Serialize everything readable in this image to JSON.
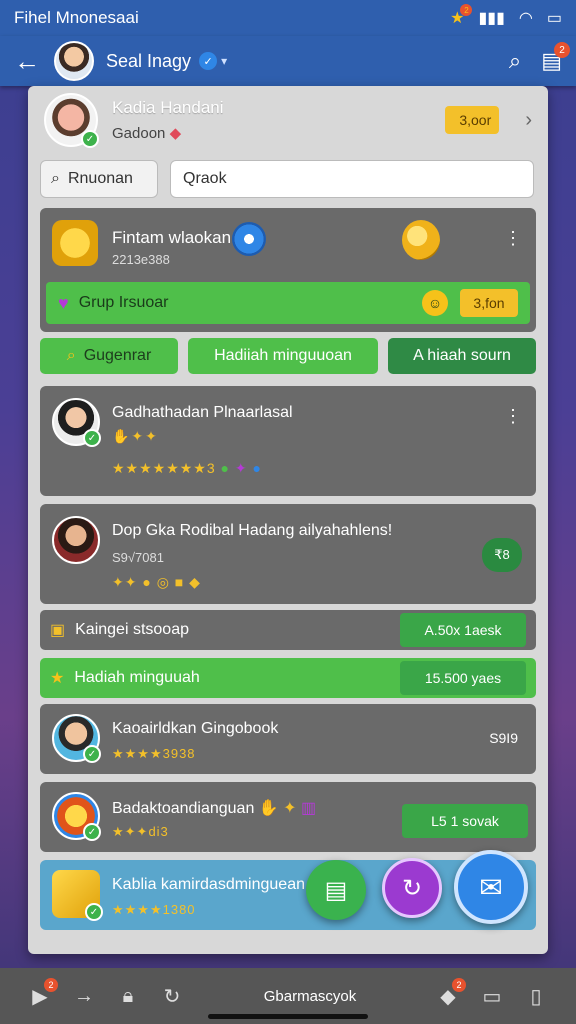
{
  "status_bar": {
    "carrier": "Fihel Mnonesaai",
    "star_badge": "2"
  },
  "app_bar": {
    "contact_name": "Seal Inagy",
    "notif_count": "2"
  },
  "profile": {
    "name": "Kadia Handani",
    "subtitle": "Gadoon",
    "coin_button": "3,oor"
  },
  "search": {
    "button_label": "Rnuonan",
    "input_value": "Qraok",
    "input_placeholder": ""
  },
  "event_card": {
    "title": "Fintam wlaokan",
    "subtitle": "2213e388",
    "strip_label": "Grup Irsuoar",
    "strip_button": "3,fon"
  },
  "tabs": [
    {
      "label": "Gugenrar"
    },
    {
      "label": "Hadiiah minguuoan"
    },
    {
      "label": "A hiaah sourn"
    }
  ],
  "user_cards": [
    {
      "name": "Gadhathadan Plnaarlasal",
      "stars": "★★★★★★★3"
    },
    {
      "name": "Dop Gka Rodibal Hadang ailyahahlens!",
      "subvalue": "S9√7081",
      "badge": "₹8"
    }
  ],
  "thin_rows": [
    {
      "label": "Kaingei stsooap",
      "value": "A.50x 1aesk"
    },
    {
      "label": "Hadiah minguuah",
      "value": "15.500 yaes"
    }
  ],
  "list_items": [
    {
      "title": "Kaoairldkan Gingobook",
      "stars": "★★★★3938",
      "right": "S9I9"
    },
    {
      "title": "Badaktoandianguan",
      "stars": "★✦✦di3",
      "right": "L5 1 sovak"
    },
    {
      "title": "Kablia kamirdasdminguean",
      "stars": "★★★★1380"
    }
  ],
  "bottom_bar": {
    "label": "Gbarmascyok",
    "badge1": "2",
    "badge2": "2"
  },
  "colors": {
    "appbar": "#2f5fae",
    "panel": "#d8d8d8",
    "card": "#6a6a6a",
    "green": "#4fbf4a",
    "gold": "#f3c02a",
    "blue": "#2f86e6",
    "purple": "#9b3ad0"
  }
}
